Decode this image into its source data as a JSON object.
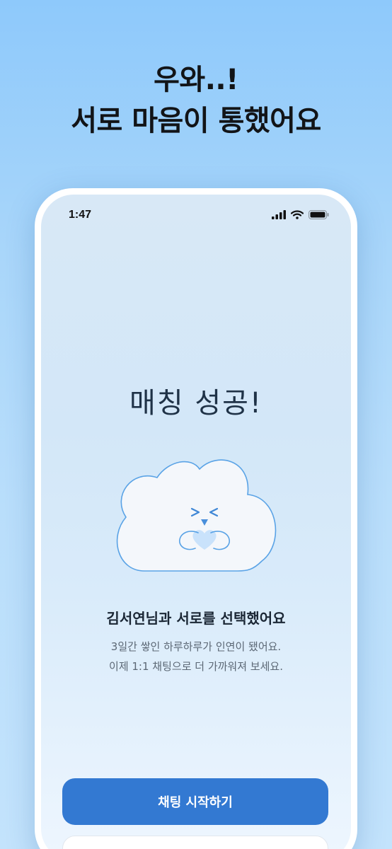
{
  "headline": {
    "line1": "우와..!",
    "line2": "서로 마음이 통했어요"
  },
  "status_bar": {
    "time": "1:47",
    "icons": [
      "signal-icon",
      "wifi-icon",
      "battery-icon"
    ]
  },
  "match": {
    "title": "매칭 성공!",
    "heading": "김서연님과 서로를 선택했어요",
    "description_line1": "3일간 쌓인 하루하루가 인연이 됐어요.",
    "description_line2": "이제 1:1 채팅으로 더 가까워져 보세요."
  },
  "actions": {
    "primary_label": "채팅 시작하기"
  },
  "colors": {
    "accent": "#3379d2",
    "background_top": "#8ec9fb",
    "cloud_outline": "#5aa3e6",
    "heart": "#c9e2fb"
  },
  "illustration": "cloud-mascot-holding-heart"
}
